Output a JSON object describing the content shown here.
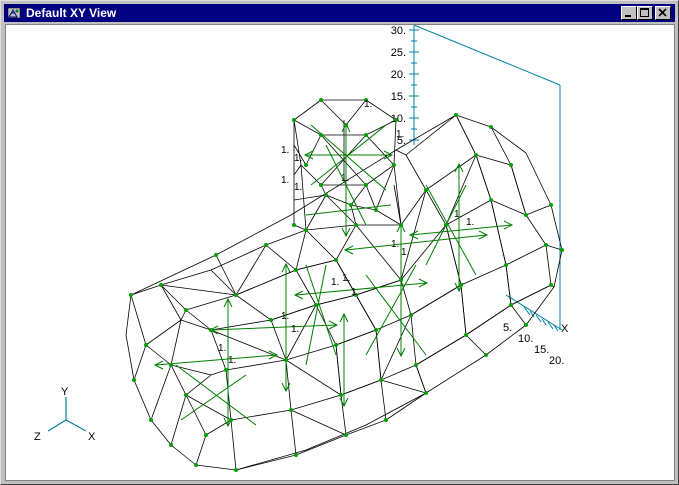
{
  "window": {
    "title": "Default XY View"
  },
  "icons": {
    "app": "app-mesh-icon",
    "minimize": "minimize-icon",
    "maximize": "maximize-icon",
    "close": "close-icon"
  },
  "colors": {
    "title_bar": "#000080",
    "mesh": "#000000",
    "load_arrows": "#008000",
    "nodes": "#00a000",
    "axis": "#0080a0"
  },
  "ruler": {
    "vertical_ticks": [
      "30.",
      "25.",
      "20.",
      "15.",
      "10.",
      "5."
    ],
    "depth_ticks": [
      "5.",
      "10.",
      "15.",
      "20."
    ],
    "axis_label": "X"
  },
  "triad": {
    "y": "Y",
    "z": "Z",
    "x": "X"
  },
  "load_labels": [
    "1.",
    "1.",
    "1.",
    "1.",
    "1.",
    "1.",
    "1.",
    "1.",
    "1.",
    "1.",
    "1.",
    "1.",
    "1.",
    "1.",
    "1.",
    "1.",
    "1.",
    "1."
  ]
}
